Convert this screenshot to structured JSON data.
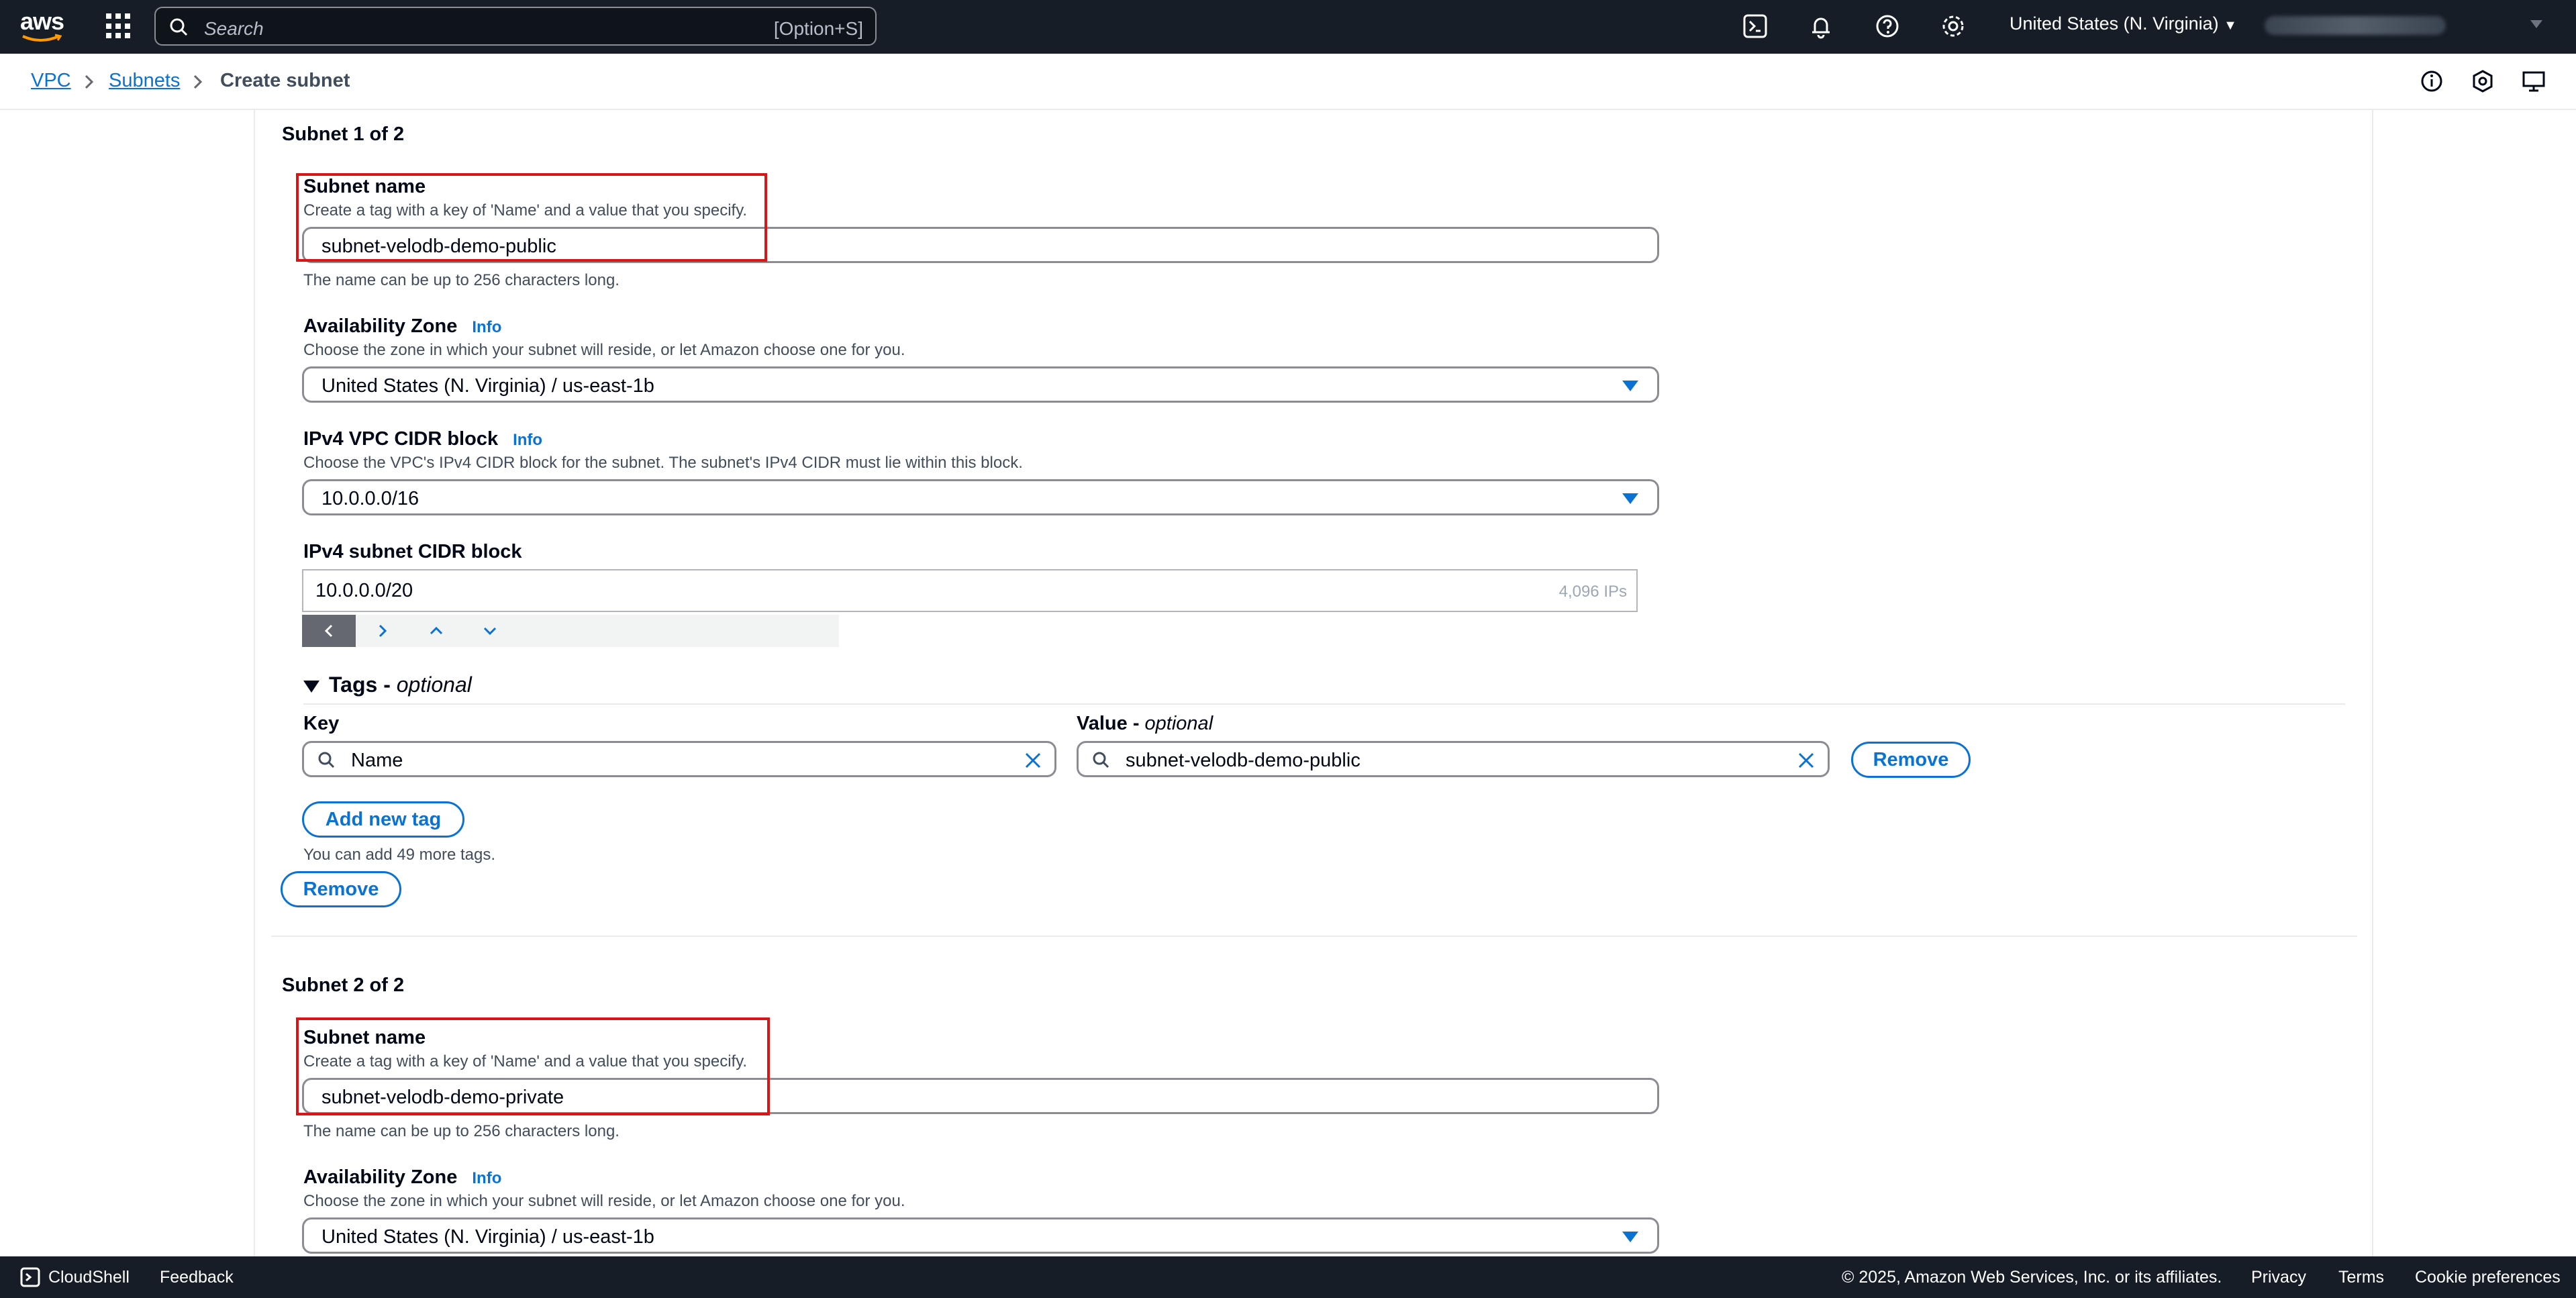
{
  "topnav": {
    "logo_text": "aws",
    "search_placeholder": "Search",
    "search_shortcut": "[Option+S]",
    "region": "United States (N. Virginia)"
  },
  "breadcrumb": {
    "items": [
      "VPC",
      "Subnets",
      "Create subnet"
    ]
  },
  "subnet1": {
    "heading": "Subnet 1 of 2",
    "name_label": "Subnet name",
    "name_desc": "Create a tag with a key of 'Name' and a value that you specify.",
    "name_value": "subnet-velodb-demo-public",
    "name_hint": "The name can be up to 256 characters long.",
    "az_label": "Availability Zone",
    "az_info": "Info",
    "az_desc": "Choose the zone in which your subnet will reside, or let Amazon choose one for you.",
    "az_value": "United States (N. Virginia) / us-east-1b",
    "vpc_cidr_label": "IPv4 VPC CIDR block",
    "vpc_cidr_info": "Info",
    "vpc_cidr_desc": "Choose the VPC's IPv4 CIDR block for the subnet. The subnet's IPv4 CIDR must lie within this block.",
    "vpc_cidr_value": "10.0.0.0/16",
    "subnet_cidr_label": "IPv4 subnet CIDR block",
    "subnet_cidr_value": "10.0.0.0/20",
    "subnet_cidr_ips": "4,096 IPs",
    "tags_label": "Tags - ",
    "tags_optional": "optional",
    "key_label": "Key",
    "value_label": "Value - ",
    "value_optional": "optional",
    "tag_key": "Name",
    "tag_value": "subnet-velodb-demo-public",
    "remove_tag": "Remove",
    "add_tag": "Add new tag",
    "tags_hint": "You can add 49 more tags.",
    "remove_subnet": "Remove"
  },
  "subnet2": {
    "heading": "Subnet 2 of 2",
    "name_label": "Subnet name",
    "name_desc": "Create a tag with a key of 'Name' and a value that you specify.",
    "name_value": "subnet-velodb-demo-private",
    "name_hint": "The name can be up to 256 characters long.",
    "az_label": "Availability Zone",
    "az_info": "Info",
    "az_desc": "Choose the zone in which your subnet will reside, or let Amazon choose one for you.",
    "az_value": "United States (N. Virginia) / us-east-1b"
  },
  "footer": {
    "cloudshell": "CloudShell",
    "feedback": "Feedback",
    "copyright": "© 2025, Amazon Web Services, Inc. or its affiliates.",
    "privacy": "Privacy",
    "terms": "Terms",
    "cookies": "Cookie preferences"
  },
  "colors": {
    "nav_bg": "#161d26",
    "link": "#0972d3",
    "highlight": "#d91515"
  }
}
